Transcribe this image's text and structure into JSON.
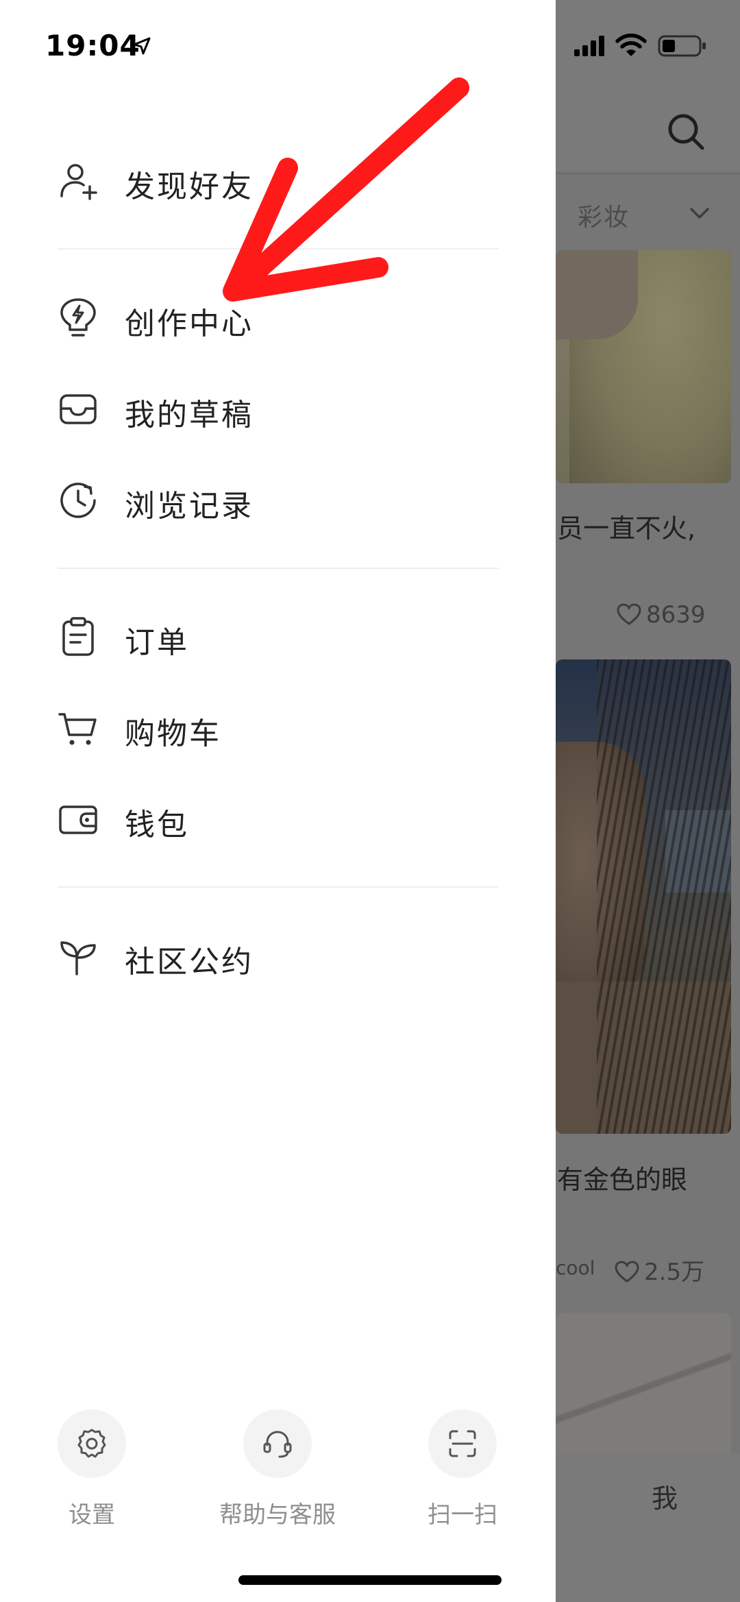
{
  "status_bar": {
    "time": "19:04",
    "icons": [
      "location-arrow-icon",
      "cellular-signal-icon",
      "wifi-icon",
      "battery-icon"
    ]
  },
  "drawer": {
    "groups": [
      [
        {
          "label": "发现好友",
          "icon": "add-friend-icon"
        }
      ],
      [
        {
          "label": "创作中心",
          "icon": "lightning-bulb-icon"
        },
        {
          "label": "我的草稿",
          "icon": "inbox-tray-icon"
        },
        {
          "label": "浏览记录",
          "icon": "history-clock-icon"
        }
      ],
      [
        {
          "label": "订单",
          "icon": "clipboard-icon"
        },
        {
          "label": "购物车",
          "icon": "cart-icon"
        },
        {
          "label": "钱包",
          "icon": "wallet-icon"
        }
      ],
      [
        {
          "label": "社区公约",
          "icon": "sprout-icon"
        }
      ]
    ],
    "bottom_actions": [
      {
        "label": "设置",
        "icon": "gear-icon"
      },
      {
        "label": "帮助与客服",
        "icon": "headset-icon"
      },
      {
        "label": "扫一扫",
        "icon": "scan-icon"
      }
    ]
  },
  "background_feed": {
    "tab_label": "彩妆",
    "posts": [
      {
        "title_fragment": "员一直不火,",
        "likes": "8639"
      },
      {
        "title_fragment": "有金色的眼",
        "author_fragment": "cool",
        "likes": "2.5万"
      }
    ],
    "nav_me": "我"
  },
  "annotation": {
    "type": "red-arrow",
    "color": "#ff1a1a",
    "points_to": "创作中心"
  },
  "colors": {
    "drawer_bg": "#ffffff",
    "text": "#222222",
    "overlay": "#6f6f6f",
    "muted": "#8e8e8e"
  }
}
